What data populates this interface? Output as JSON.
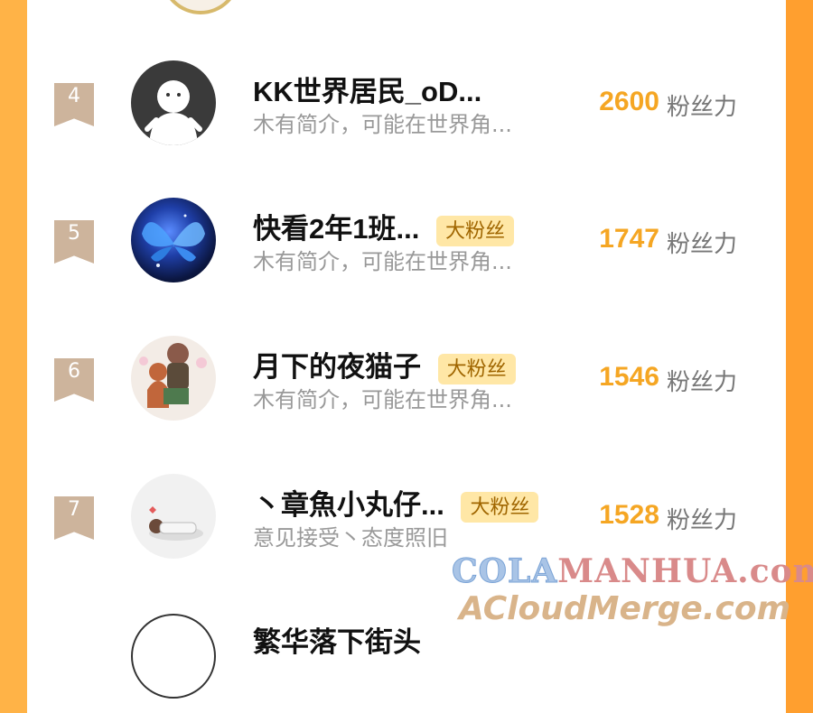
{
  "rows": [
    {
      "rank": "4",
      "name": "KK世界居民_oD...",
      "badge": "",
      "bio": "木有简介，可能在世界角...",
      "score": "2600",
      "score_label": "粉丝力"
    },
    {
      "rank": "5",
      "name": "快看2年1班...",
      "badge": "大粉丝",
      "bio": "木有简介，可能在世界角...",
      "score": "1747",
      "score_label": "粉丝力"
    },
    {
      "rank": "6",
      "name": "月下的夜猫子",
      "badge": "大粉丝",
      "bio": "木有简介，可能在世界角...",
      "score": "1546",
      "score_label": "粉丝力"
    },
    {
      "rank": "7",
      "name": "丶章魚小丸仔...",
      "badge": "大粉丝",
      "bio": "意见接受丶态度照旧",
      "score": "1528",
      "score_label": "粉丝力"
    },
    {
      "rank": "",
      "name": "繁华落下街头",
      "badge": "",
      "bio": "",
      "score": "",
      "score_label": ""
    }
  ],
  "watermark": {
    "line1_a": "COLA",
    "line1_b": "MANHUA.com",
    "line2": "ACloudMerge.com"
  },
  "colors": {
    "accent": "#f5a623",
    "rank_bg": "#cdb49c",
    "badge_bg": "#ffe7a6",
    "frame": "#ffb347"
  }
}
